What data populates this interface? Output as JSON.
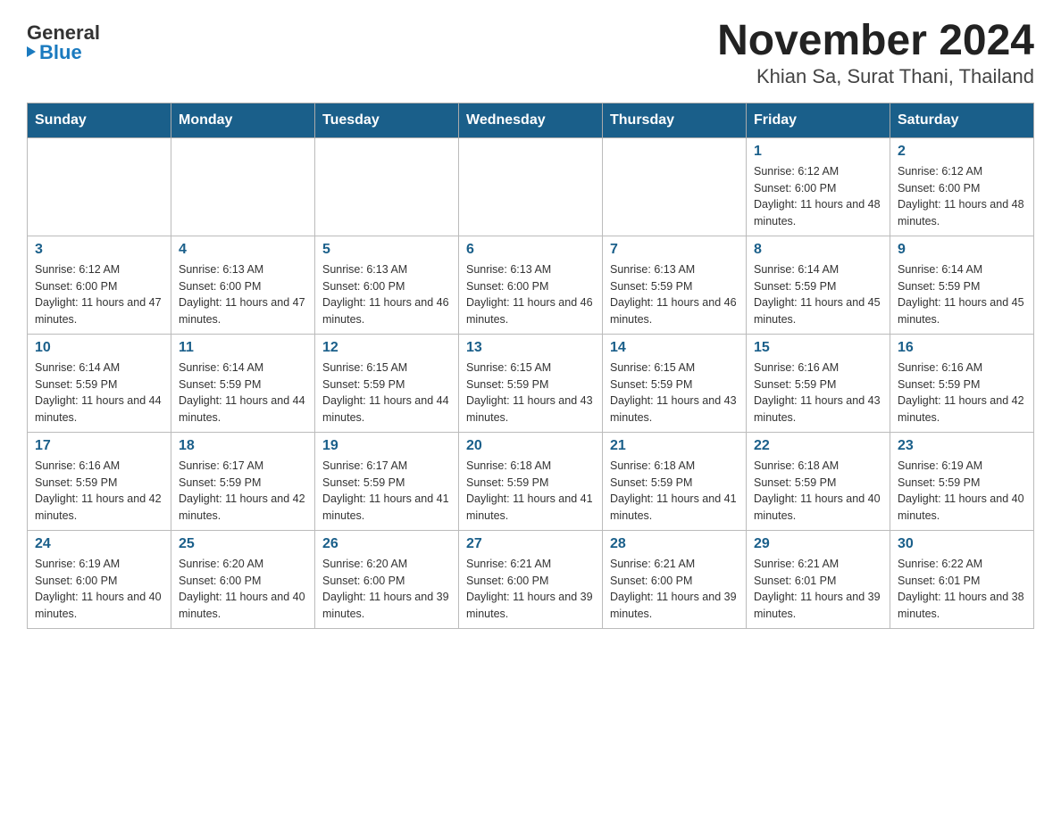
{
  "logo": {
    "general": "General",
    "blue": "Blue"
  },
  "title": "November 2024",
  "subtitle": "Khian Sa, Surat Thani, Thailand",
  "days_of_week": [
    "Sunday",
    "Monday",
    "Tuesday",
    "Wednesday",
    "Thursday",
    "Friday",
    "Saturday"
  ],
  "weeks": [
    [
      {
        "day": "",
        "info": ""
      },
      {
        "day": "",
        "info": ""
      },
      {
        "day": "",
        "info": ""
      },
      {
        "day": "",
        "info": ""
      },
      {
        "day": "",
        "info": ""
      },
      {
        "day": "1",
        "info": "Sunrise: 6:12 AM\nSunset: 6:00 PM\nDaylight: 11 hours and 48 minutes."
      },
      {
        "day": "2",
        "info": "Sunrise: 6:12 AM\nSunset: 6:00 PM\nDaylight: 11 hours and 48 minutes."
      }
    ],
    [
      {
        "day": "3",
        "info": "Sunrise: 6:12 AM\nSunset: 6:00 PM\nDaylight: 11 hours and 47 minutes."
      },
      {
        "day": "4",
        "info": "Sunrise: 6:13 AM\nSunset: 6:00 PM\nDaylight: 11 hours and 47 minutes."
      },
      {
        "day": "5",
        "info": "Sunrise: 6:13 AM\nSunset: 6:00 PM\nDaylight: 11 hours and 46 minutes."
      },
      {
        "day": "6",
        "info": "Sunrise: 6:13 AM\nSunset: 6:00 PM\nDaylight: 11 hours and 46 minutes."
      },
      {
        "day": "7",
        "info": "Sunrise: 6:13 AM\nSunset: 5:59 PM\nDaylight: 11 hours and 46 minutes."
      },
      {
        "day": "8",
        "info": "Sunrise: 6:14 AM\nSunset: 5:59 PM\nDaylight: 11 hours and 45 minutes."
      },
      {
        "day": "9",
        "info": "Sunrise: 6:14 AM\nSunset: 5:59 PM\nDaylight: 11 hours and 45 minutes."
      }
    ],
    [
      {
        "day": "10",
        "info": "Sunrise: 6:14 AM\nSunset: 5:59 PM\nDaylight: 11 hours and 44 minutes."
      },
      {
        "day": "11",
        "info": "Sunrise: 6:14 AM\nSunset: 5:59 PM\nDaylight: 11 hours and 44 minutes."
      },
      {
        "day": "12",
        "info": "Sunrise: 6:15 AM\nSunset: 5:59 PM\nDaylight: 11 hours and 44 minutes."
      },
      {
        "day": "13",
        "info": "Sunrise: 6:15 AM\nSunset: 5:59 PM\nDaylight: 11 hours and 43 minutes."
      },
      {
        "day": "14",
        "info": "Sunrise: 6:15 AM\nSunset: 5:59 PM\nDaylight: 11 hours and 43 minutes."
      },
      {
        "day": "15",
        "info": "Sunrise: 6:16 AM\nSunset: 5:59 PM\nDaylight: 11 hours and 43 minutes."
      },
      {
        "day": "16",
        "info": "Sunrise: 6:16 AM\nSunset: 5:59 PM\nDaylight: 11 hours and 42 minutes."
      }
    ],
    [
      {
        "day": "17",
        "info": "Sunrise: 6:16 AM\nSunset: 5:59 PM\nDaylight: 11 hours and 42 minutes."
      },
      {
        "day": "18",
        "info": "Sunrise: 6:17 AM\nSunset: 5:59 PM\nDaylight: 11 hours and 42 minutes."
      },
      {
        "day": "19",
        "info": "Sunrise: 6:17 AM\nSunset: 5:59 PM\nDaylight: 11 hours and 41 minutes."
      },
      {
        "day": "20",
        "info": "Sunrise: 6:18 AM\nSunset: 5:59 PM\nDaylight: 11 hours and 41 minutes."
      },
      {
        "day": "21",
        "info": "Sunrise: 6:18 AM\nSunset: 5:59 PM\nDaylight: 11 hours and 41 minutes."
      },
      {
        "day": "22",
        "info": "Sunrise: 6:18 AM\nSunset: 5:59 PM\nDaylight: 11 hours and 40 minutes."
      },
      {
        "day": "23",
        "info": "Sunrise: 6:19 AM\nSunset: 5:59 PM\nDaylight: 11 hours and 40 minutes."
      }
    ],
    [
      {
        "day": "24",
        "info": "Sunrise: 6:19 AM\nSunset: 6:00 PM\nDaylight: 11 hours and 40 minutes."
      },
      {
        "day": "25",
        "info": "Sunrise: 6:20 AM\nSunset: 6:00 PM\nDaylight: 11 hours and 40 minutes."
      },
      {
        "day": "26",
        "info": "Sunrise: 6:20 AM\nSunset: 6:00 PM\nDaylight: 11 hours and 39 minutes."
      },
      {
        "day": "27",
        "info": "Sunrise: 6:21 AM\nSunset: 6:00 PM\nDaylight: 11 hours and 39 minutes."
      },
      {
        "day": "28",
        "info": "Sunrise: 6:21 AM\nSunset: 6:00 PM\nDaylight: 11 hours and 39 minutes."
      },
      {
        "day": "29",
        "info": "Sunrise: 6:21 AM\nSunset: 6:01 PM\nDaylight: 11 hours and 39 minutes."
      },
      {
        "day": "30",
        "info": "Sunrise: 6:22 AM\nSunset: 6:01 PM\nDaylight: 11 hours and 38 minutes."
      }
    ]
  ]
}
